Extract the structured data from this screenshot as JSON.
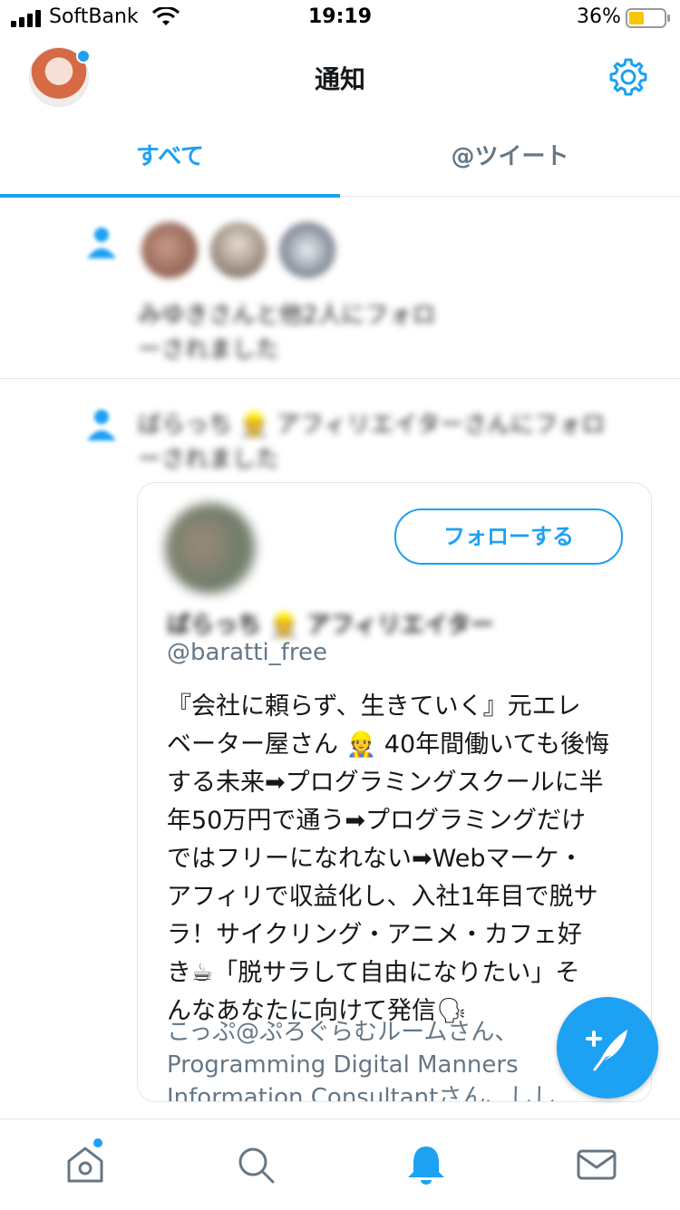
{
  "status_bar": {
    "carrier": "SoftBank",
    "time": "19:19",
    "battery": "36%"
  },
  "header": {
    "title": "通知"
  },
  "tabs": {
    "all": "すべて",
    "tweets": "@ツイート"
  },
  "notifications": [
    {
      "type": "follow-group",
      "text_line1": "みゆきさんと他2人にフォロ",
      "text_line2": "ーされました"
    },
    {
      "type": "follow",
      "text_line1": "ばらっち 👷 アフィリエイターさんにフォロ",
      "text_line2": "ーされました",
      "card": {
        "follow_button": "フォローする",
        "name": "ばらっち 👷 アフィリエイター",
        "handle": "@baratti_free",
        "bio": [
          "『会社に頼らず、生きていく』元エレ",
          "ベーター屋さん 👷 40年間働いても後悔",
          "する未来➡プログラミングスクールに半",
          "年50万円で通う➡プログラミングだけ",
          "ではフリーになれない➡Webマーケ・",
          "アフィリで収益化し、入社1年目で脱サ",
          "ラ！サイクリング・アニメ・カフェ好",
          "き☕「脱サラして自由になりたい」そ",
          "んなあなたに向けて発信🗣"
        ],
        "followed_by": [
          "こっぷ@ぷろぐらむルームさん、",
          "Programming Digital Manners",
          "Information Consultantさん、しし"
        ]
      }
    }
  ],
  "colors": {
    "accent": "#1da1f2",
    "secondary_text": "#657786",
    "divider": "#e1e8ed"
  },
  "icons": {
    "tabbar": [
      "home-icon",
      "search-icon",
      "notifications-bell-icon",
      "messages-envelope-icon"
    ],
    "fab": "compose-tweet-icon",
    "settings": "gear-icon"
  }
}
